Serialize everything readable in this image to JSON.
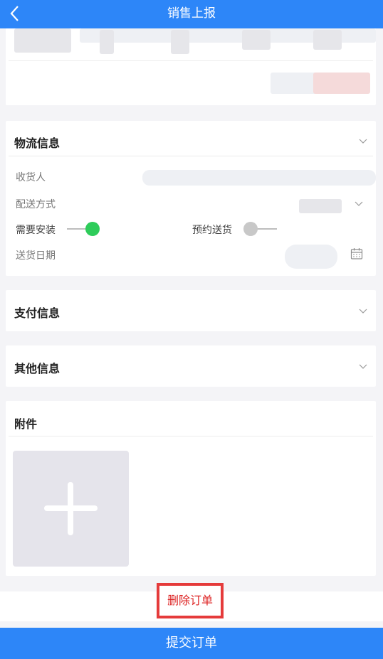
{
  "header": {
    "title": "销售上报",
    "back_icon": "chevron-left-icon"
  },
  "logistics": {
    "title": "物流信息",
    "receiver_label": "收货人",
    "delivery_method_label": "配送方式",
    "install_label": "需要安装",
    "install_enabled": true,
    "scheduled_label": "预约送货",
    "scheduled_enabled": false,
    "delivery_date_label": "送货日期"
  },
  "payment": {
    "title": "支付信息"
  },
  "other": {
    "title": "其他信息"
  },
  "attachment": {
    "title": "附件",
    "add_icon": "plus-icon"
  },
  "actions": {
    "delete_label": "删除订单",
    "submit_label": "提交订单"
  },
  "colors": {
    "primary": "#2d86f8",
    "toggle_on": "#2ecc5a",
    "toggle_off": "#bdbdbd",
    "danger": "#e53b3b"
  }
}
